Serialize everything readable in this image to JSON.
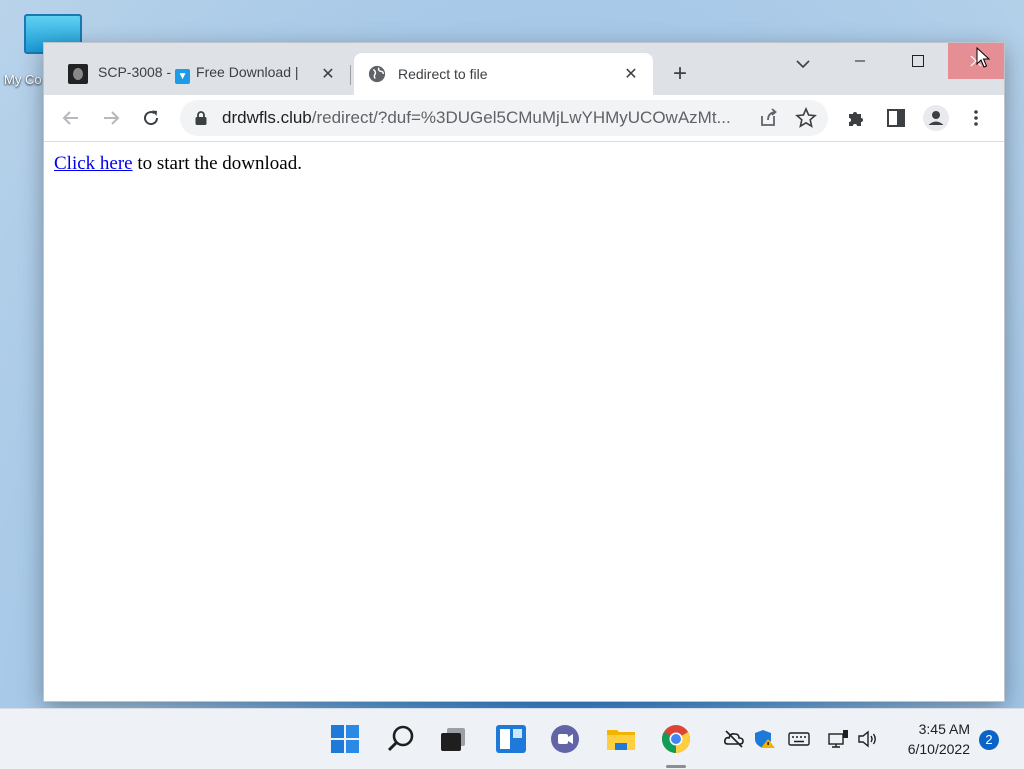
{
  "desktop": {
    "icon_label": "My Co"
  },
  "browser": {
    "tabs": [
      {
        "title_prefix": "SCP-3008 - ",
        "title_suffix": "Free Download | ",
        "active": false
      },
      {
        "title": "Redirect to file",
        "active": true
      }
    ],
    "new_tab_label": "+",
    "address_bar": {
      "domain": "drdwfls.club",
      "path": "/redirect/?duf=%3DUGel5CMuMjLwYHMyUCOwAzMt..."
    }
  },
  "page": {
    "link_text": "Click here",
    "rest_text": " to start the download."
  },
  "taskbar": {
    "time": "3:45 AM",
    "date": "6/10/2022",
    "notification_count": "2"
  }
}
